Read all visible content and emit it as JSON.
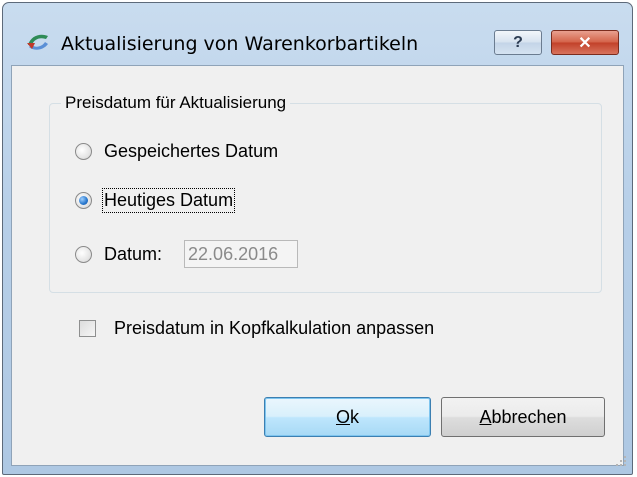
{
  "window": {
    "title": "Aktualisierung von Warenkorbartikeln",
    "help_label": "?",
    "close_label": "✕",
    "icon": "app-icon"
  },
  "group": {
    "legend": "Preisdatum für Aktualisierung",
    "options": [
      {
        "label": "Gespeichertes Datum",
        "selected": false
      },
      {
        "label": "Heutiges Datum",
        "selected": true
      },
      {
        "label": "Datum:",
        "selected": false
      }
    ],
    "date_value": "22.06.2016"
  },
  "checkbox": {
    "label": "Preisdatum in Kopfkalkulation anpassen",
    "checked": false
  },
  "buttons": {
    "ok_mnemonic": "O",
    "ok_rest": "k",
    "cancel_mnemonic": "A",
    "cancel_rest": "bbrechen"
  }
}
